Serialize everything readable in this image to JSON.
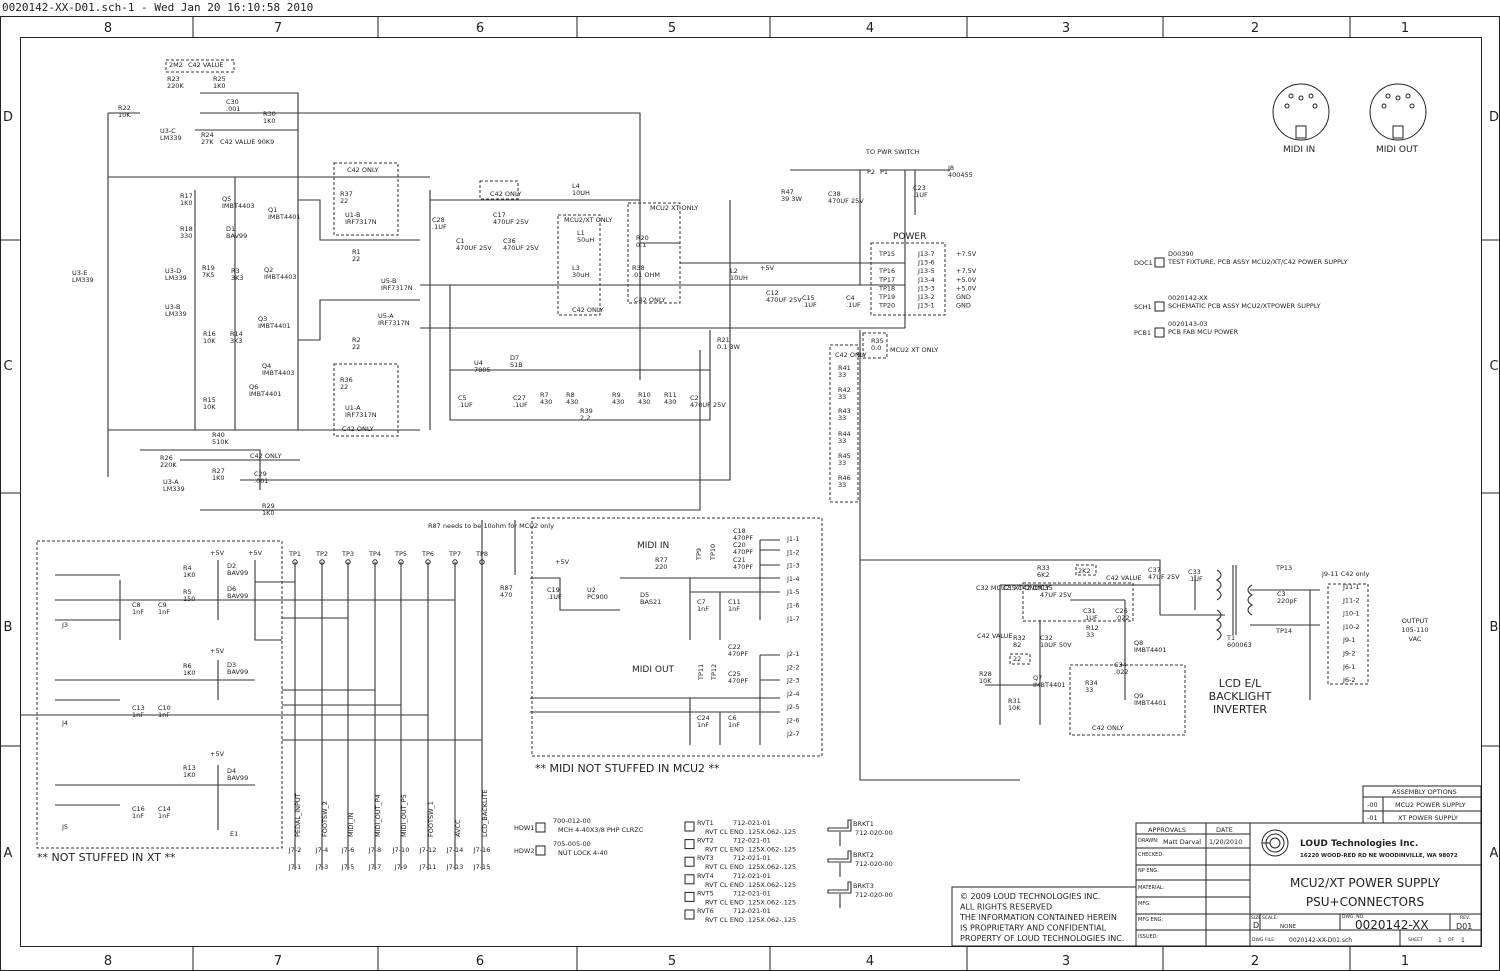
{
  "header": {
    "title": "0020142-XX-D01.sch-1 - Wed Jan 20 16:10:58 2010"
  },
  "grid": {
    "columns": [
      "8",
      "7",
      "6",
      "5",
      "4",
      "3",
      "2",
      "1"
    ],
    "rows": [
      "D",
      "C",
      "B",
      "A"
    ]
  },
  "components": [
    {
      "ref": "R22",
      "value": "10K"
    },
    {
      "ref": "R23",
      "value": "220K"
    },
    {
      "ref": "R25",
      "value": "1K0"
    },
    {
      "ref": "C30",
      "value": ".001"
    },
    {
      "ref": "R30",
      "value": "1K0"
    },
    {
      "ref": "R24",
      "value": "27K"
    },
    {
      "ref": "U3-C",
      "value": "LM339"
    },
    {
      "ref": "R17",
      "value": "1K0"
    },
    {
      "ref": "Q5",
      "value": "IMBT4403"
    },
    {
      "ref": "D1",
      "value": "BAV99"
    },
    {
      "ref": "R18",
      "value": "330"
    },
    {
      "ref": "Q1",
      "value": "IMBT4401"
    },
    {
      "ref": "R19",
      "value": "7K5"
    },
    {
      "ref": "R3",
      "value": "3K3"
    },
    {
      "ref": "Q2",
      "value": "IMBT4403"
    },
    {
      "ref": "U3-D",
      "value": "LM339"
    },
    {
      "ref": "U3-B",
      "value": "LM339"
    },
    {
      "ref": "U3-E",
      "value": "LM339"
    },
    {
      "ref": "R16",
      "value": "10K"
    },
    {
      "ref": "R14",
      "value": "3K3"
    },
    {
      "ref": "Q3",
      "value": "IMBT4401"
    },
    {
      "ref": "Q4",
      "value": "IMBT4403"
    },
    {
      "ref": "Q6",
      "value": "IMBT4401"
    },
    {
      "ref": "R15",
      "value": "10K"
    },
    {
      "ref": "R37",
      "value": "22"
    },
    {
      "ref": "U1-B",
      "value": "IRF7317N"
    },
    {
      "ref": "R1",
      "value": "22"
    },
    {
      "ref": "U5-B",
      "value": "IRF7317N"
    },
    {
      "ref": "U5-A",
      "value": "IRF7317N"
    },
    {
      "ref": "R2",
      "value": "22"
    },
    {
      "ref": "R36",
      "value": "22"
    },
    {
      "ref": "U1-A",
      "value": "IRF7317N"
    },
    {
      "ref": "C28",
      "value": ".1UF"
    },
    {
      "ref": "C1",
      "value": "470UF 25V"
    },
    {
      "ref": "C17",
      "value": "470UF 25V"
    },
    {
      "ref": "C36",
      "value": "470UF 25V"
    },
    {
      "ref": "L4",
      "value": "10UH"
    },
    {
      "ref": "L1",
      "value": "50uH"
    },
    {
      "ref": "L3",
      "value": "30uH"
    },
    {
      "ref": "R20",
      "value": "0.1"
    },
    {
      "ref": "R38",
      "value": ".01 OHM"
    },
    {
      "ref": "L2",
      "value": "10UH"
    },
    {
      "ref": "C12",
      "value": "470UF 25V"
    },
    {
      "ref": "C15",
      "value": ".1UF"
    },
    {
      "ref": "C4",
      "value": ".1UF"
    },
    {
      "ref": "R47",
      "value": "39 3W"
    },
    {
      "ref": "C38",
      "value": "470UF 25V"
    },
    {
      "ref": "C23",
      "value": ".1UF"
    },
    {
      "ref": "J8",
      "value": "400455"
    },
    {
      "ref": "R21",
      "value": "0.1 3W"
    },
    {
      "ref": "D7",
      "value": "S1B"
    },
    {
      "ref": "U4",
      "value": "7805"
    },
    {
      "ref": "C5",
      "value": ".1UF"
    },
    {
      "ref": "C27",
      "value": ".1UF"
    },
    {
      "ref": "R7",
      "value": "430"
    },
    {
      "ref": "R8",
      "value": "430"
    },
    {
      "ref": "R9",
      "value": "430"
    },
    {
      "ref": "R10",
      "value": "430"
    },
    {
      "ref": "R11",
      "value": "430"
    },
    {
      "ref": "R39",
      "value": "2.2"
    },
    {
      "ref": "C2",
      "value": "470UF 25V"
    },
    {
      "ref": "R40",
      "value": "510K"
    },
    {
      "ref": "R26",
      "value": "220K"
    },
    {
      "ref": "R27",
      "value": "1K0"
    },
    {
      "ref": "C29",
      "value": ".001"
    },
    {
      "ref": "R29",
      "value": "1K0"
    },
    {
      "ref": "U3-A",
      "value": "LM339"
    },
    {
      "ref": "R35",
      "value": "0.0"
    },
    {
      "ref": "R41",
      "value": "33"
    },
    {
      "ref": "R42",
      "value": "33"
    },
    {
      "ref": "R43",
      "value": "33"
    },
    {
      "ref": "R44",
      "value": "33"
    },
    {
      "ref": "R45",
      "value": "33"
    },
    {
      "ref": "R46",
      "value": "33"
    },
    {
      "ref": "R4",
      "value": "1K0"
    },
    {
      "ref": "D2",
      "value": "BAV99"
    },
    {
      "ref": "R5",
      "value": "150"
    },
    {
      "ref": "D6",
      "value": "BAV99"
    },
    {
      "ref": "C8",
      "value": "1nF"
    },
    {
      "ref": "C9",
      "value": "1nF"
    },
    {
      "ref": "J3",
      "value": ""
    },
    {
      "ref": "R6",
      "value": "1K0"
    },
    {
      "ref": "D3",
      "value": "BAV99"
    },
    {
      "ref": "C13",
      "value": "1nF"
    },
    {
      "ref": "C10",
      "value": "1nF"
    },
    {
      "ref": "J4",
      "value": ""
    },
    {
      "ref": "R13",
      "value": "1K0"
    },
    {
      "ref": "D4",
      "value": "BAV99"
    },
    {
      "ref": "C16",
      "value": "1nF"
    },
    {
      "ref": "C14",
      "value": "1nF"
    },
    {
      "ref": "J5",
      "value": ""
    },
    {
      "ref": "E1",
      "value": ""
    },
    {
      "ref": "R87",
      "value": "470"
    },
    {
      "ref": "C19",
      "value": ".1UF"
    },
    {
      "ref": "U2",
      "value": "PC900"
    },
    {
      "ref": "D5",
      "value": "BAS21"
    },
    {
      "ref": "R77",
      "value": "220"
    },
    {
      "ref": "C7",
      "value": "1nF"
    },
    {
      "ref": "C11",
      "value": "1nF"
    },
    {
      "ref": "C18",
      "value": "470PF"
    },
    {
      "ref": "C20",
      "value": "470PF"
    },
    {
      "ref": "C21",
      "value": "470PF"
    },
    {
      "ref": "C22",
      "value": "470PF"
    },
    {
      "ref": "C25",
      "value": "470PF"
    },
    {
      "ref": "C24",
      "value": "1nF"
    },
    {
      "ref": "C6",
      "value": "1nF"
    },
    {
      "ref": "R33",
      "value": "6K2"
    },
    {
      "ref": "C35",
      "value": "47UF 25V"
    },
    {
      "ref": "C31",
      "value": ".1UF"
    },
    {
      "ref": "C26",
      "value": ".022"
    },
    {
      "ref": "R12",
      "value": "33"
    },
    {
      "ref": "C32",
      "value": "10UF 50V"
    },
    {
      "ref": "R32",
      "value": "82"
    },
    {
      "ref": "Q8",
      "value": "IMBT4401"
    },
    {
      "ref": "R28",
      "value": "10K"
    },
    {
      "ref": "Q7",
      "value": "IMBT4401"
    },
    {
      "ref": "R31",
      "value": "10K"
    },
    {
      "ref": "C34",
      "value": ".022"
    },
    {
      "ref": "R34",
      "value": "33"
    },
    {
      "ref": "Q9",
      "value": "IMBT4401"
    },
    {
      "ref": "C37",
      "value": "47UF 25V"
    },
    {
      "ref": "C33",
      "value": ".1UF"
    },
    {
      "ref": "T1",
      "value": "600063"
    },
    {
      "ref": "C3",
      "value": "220pF"
    }
  ],
  "notes": {
    "c42_value_top": "C42 VALUE",
    "r23_alt": "2M2",
    "r24_alt": "C42 VALUE 90K9",
    "c42_only_1": "C42 ONLY",
    "c42_only_2": "C42 ONLY",
    "c42_only_3": "C42 ONLY",
    "c42_only_4": "C42 ONLY",
    "c42_only_5": "C42 ONLY",
    "c42_only_r40": "C42 ONLY",
    "c42_only_r41": "C42 ONLY",
    "mcu2_xt_only": "MCU2/XT ONLY",
    "mcu2_xt_only_2": "MCU2 XT ONLY",
    "mcu2_xt_only_r35": "MCU2 XT ONLY",
    "to_pwr_switch": "TO PWR SWITCH",
    "p2": "P2",
    "p1": "P1",
    "plus5v_1": "+5V",
    "plus5v_2": "+5V",
    "plus5v_3": "+5V",
    "plus5v_4": "+5V",
    "plus5v_5": "+5V",
    "plus5v_6": "+5V",
    "r87_note": "R87 needs to be 10ohm for MCU2 only",
    "midi_in_title": "MIDI IN",
    "midi_out_title": "MIDI OUT",
    "midi_not_stuffed": "** MIDI NOT STUFFED IN MCU2 **",
    "not_stuffed_xt": "** NOT STUFFED IN XT **",
    "lcd_inverter": [
      "LCD E/L",
      "BACKLIGHT",
      "INVERTER"
    ],
    "r33_alt": "2K2",
    "c42_value_r33": "C42 VALUE",
    "c32_note": "C32 MCU2, XT ONLY",
    "c35_note": "C35 C42 ONLY",
    "c42_value_r32": "C42 VALUE",
    "r32_alt": "22",
    "c42_only_q9": "C42 ONLY",
    "j9_11_note": "J9-11 C42 only",
    "output": [
      "OUTPUT",
      "105-110",
      "VAC"
    ],
    "tp13": "TP13",
    "tp14": "TP14",
    "midi_in_conn": "MIDI IN",
    "midi_out_conn": "MIDI OUT",
    "power_title": "POWER"
  },
  "power_connector": [
    {
      "tp": "TP15",
      "pin": "J13-7",
      "net": "+7.5V"
    },
    {
      "tp": "",
      "pin": "J13-6",
      "net": ""
    },
    {
      "tp": "TP16",
      "pin": "J13-5",
      "net": "+7.5V"
    },
    {
      "tp": "TP17",
      "pin": "J13-4",
      "net": "+5.0V"
    },
    {
      "tp": "TP18",
      "pin": "J13-3",
      "net": "+5.0V"
    },
    {
      "tp": "TP19",
      "pin": "J13-2",
      "net": "GND"
    },
    {
      "tp": "TP20",
      "pin": "J13-1",
      "net": "GND"
    }
  ],
  "midi_in_pins": [
    "J1-1",
    "J1-2",
    "J1-3",
    "J1-4",
    "J1-5",
    "J1-6",
    "J1-7"
  ],
  "midi_out_pins": [
    "J2-1",
    "J2-2",
    "J2-3",
    "J2-4",
    "J2-5",
    "J2-6",
    "J2-7"
  ],
  "midi_tps": [
    "TP9",
    "TP10",
    "TP11",
    "TP12"
  ],
  "output_pins": [
    "J11-1",
    "J11-2",
    "J10-1",
    "J10-2",
    "J9-1",
    "J9-2",
    "J6-1",
    "J6-2"
  ],
  "test_points": [
    "TP1",
    "TP2",
    "TP3",
    "TP4",
    "TP5",
    "TP6",
    "TP7",
    "TP8"
  ],
  "j7_nets": [
    "PEDAL_INPUT",
    "FOOTSW_2",
    "MIDI_IN",
    "MIDI_OUT_P4",
    "MIDI_OUT_P5",
    "FOOTSW_1",
    "AVCC",
    "LCD_BACKLITE"
  ],
  "j7_even": [
    "J7-2",
    "J7-4",
    "J7-6",
    "J7-8",
    "J7-10",
    "J7-12",
    "J7-14",
    "J7-16"
  ],
  "j7_odd": [
    "J7-1",
    "J7-3",
    "J7-5",
    "J7-7",
    "J7-9",
    "J7-11",
    "J7-13",
    "J7-15"
  ],
  "documents": [
    {
      "ref": "DOC1",
      "part": "D00390",
      "desc": "TEST FIXTURE, PCB ASSY MCU2/XT/C42 POWER SUPPLY"
    },
    {
      "ref": "SCH1",
      "part": "0020142-XX",
      "desc": "SCHEMATIC PCB ASSY MCU2/XTPOWER SUPPLY"
    },
    {
      "ref": "PCB1",
      "part": "0020143-03",
      "desc": "PCB FAB MCU POWER"
    }
  ],
  "hardware": [
    {
      "ref": "HDW1",
      "part": "700-012-00",
      "desc": "MCH 4-40X3/8 PHP CLRZC"
    },
    {
      "ref": "HDW2",
      "part": "705-005-00",
      "desc": "NUT LOCK 4-40"
    }
  ],
  "rivets": [
    {
      "ref": "RVT1",
      "part": "712-021-01",
      "desc": "RVT CL END .125X.062-.125"
    },
    {
      "ref": "RVT2",
      "part": "712-021-01",
      "desc": "RVT CL END .125X.062-.125"
    },
    {
      "ref": "RVT3",
      "part": "712-021-01",
      "desc": "RVT CL END .125X.062-.125"
    },
    {
      "ref": "RVT4",
      "part": "712-021-01",
      "desc": "RVT CL END .125X.062-.125"
    },
    {
      "ref": "RVT5",
      "part": "712-021-01",
      "desc": "RVT CL END .125X.062-.125"
    },
    {
      "ref": "RVT6",
      "part": "712-021-01",
      "desc": "RVT CL END .125X.062-.125"
    }
  ],
  "brackets": [
    {
      "ref": "BRKT1",
      "part": "712-020-00"
    },
    {
      "ref": "BRKT2",
      "part": "712-020-00"
    },
    {
      "ref": "BRKT3",
      "part": "712-020-00"
    }
  ],
  "assembly_options": {
    "title": "ASSEMBLY OPTIONS",
    "rows": [
      {
        "code": "-00",
        "desc": "MCU2 POWER SUPPLY"
      },
      {
        "code": "-01",
        "desc": "XT POWER SUPPLY"
      }
    ]
  },
  "title_block": {
    "approvals": "APPROVALS",
    "date_header": "DATE",
    "drawn_label": "DRAWN:",
    "drawn_by": "Matt Darval",
    "drawn_date": "1/20/2010",
    "checked_label": "CHECKED:",
    "np_eng_label": "NP ENG:",
    "material_label": "MATERIAL:",
    "mfg_label": "MFG:",
    "mfg_eng_label": "MFG ENG:",
    "issued_label": "ISSUED:",
    "company": "LOUD Technologies Inc.",
    "address": "16220 WOOD-RED RD NE WOODINVILLE, WA 98072",
    "title1": "MCU2/XT POWER SUPPLY",
    "title2": "PSU+CONNECTORS",
    "size_label": "SIZE",
    "size": "D",
    "scale_label": "SCALE:",
    "scale": "NONE",
    "dwg_no_label": "DWG. NO.",
    "dwg_no": "0020142-XX",
    "rev_label": "REV.",
    "rev": "D01",
    "dwg_file_label": "DWG FILE:",
    "dwg_file": "0020142-XX-D01.sch",
    "sheet_label": "SHEET",
    "sheet": "1",
    "of_label": "OF",
    "sheets": "1"
  },
  "copyright": [
    "© 2009 LOUD TECHNOLOGIES INC.",
    "ALL RIGHTS RESERVED",
    "THE INFORMATION CONTAINED HEREIN",
    "IS PROPRIETARY AND CONFIDENTIAL",
    "PROPERTY OF LOUD TECHNOLOGIES INC."
  ]
}
